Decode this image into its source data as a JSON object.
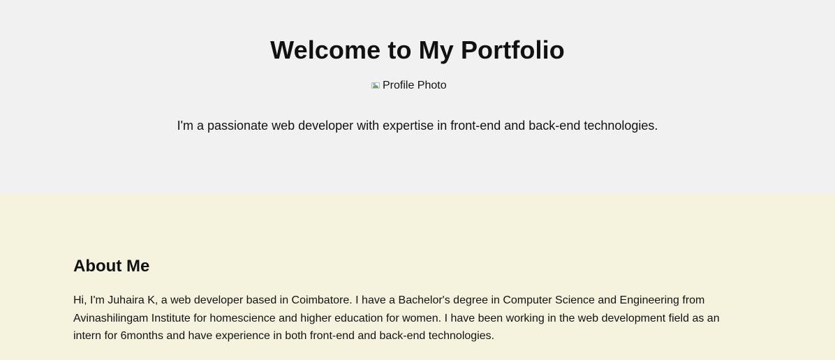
{
  "hero": {
    "title": "Welcome to My Portfolio",
    "profile_image_alt": "Profile Photo",
    "image_icon": "broken-image-icon",
    "tagline": "I'm a passionate web developer with expertise in front-end and back-end technologies."
  },
  "about": {
    "heading": "About Me",
    "paragraph": "Hi, I'm Juhaira K, a web developer based in Coimbatore. I have a Bachelor's degree in Computer Science and Engineering from Avinashilingam Institute for homescience and higher education for women. I have been working in the web development field as an intern for 6months and have experience in both front-end and back-end technologies."
  },
  "colors": {
    "hero_background": "#f2f1f2",
    "about_background": "#f5f3de",
    "text": "#111111"
  }
}
